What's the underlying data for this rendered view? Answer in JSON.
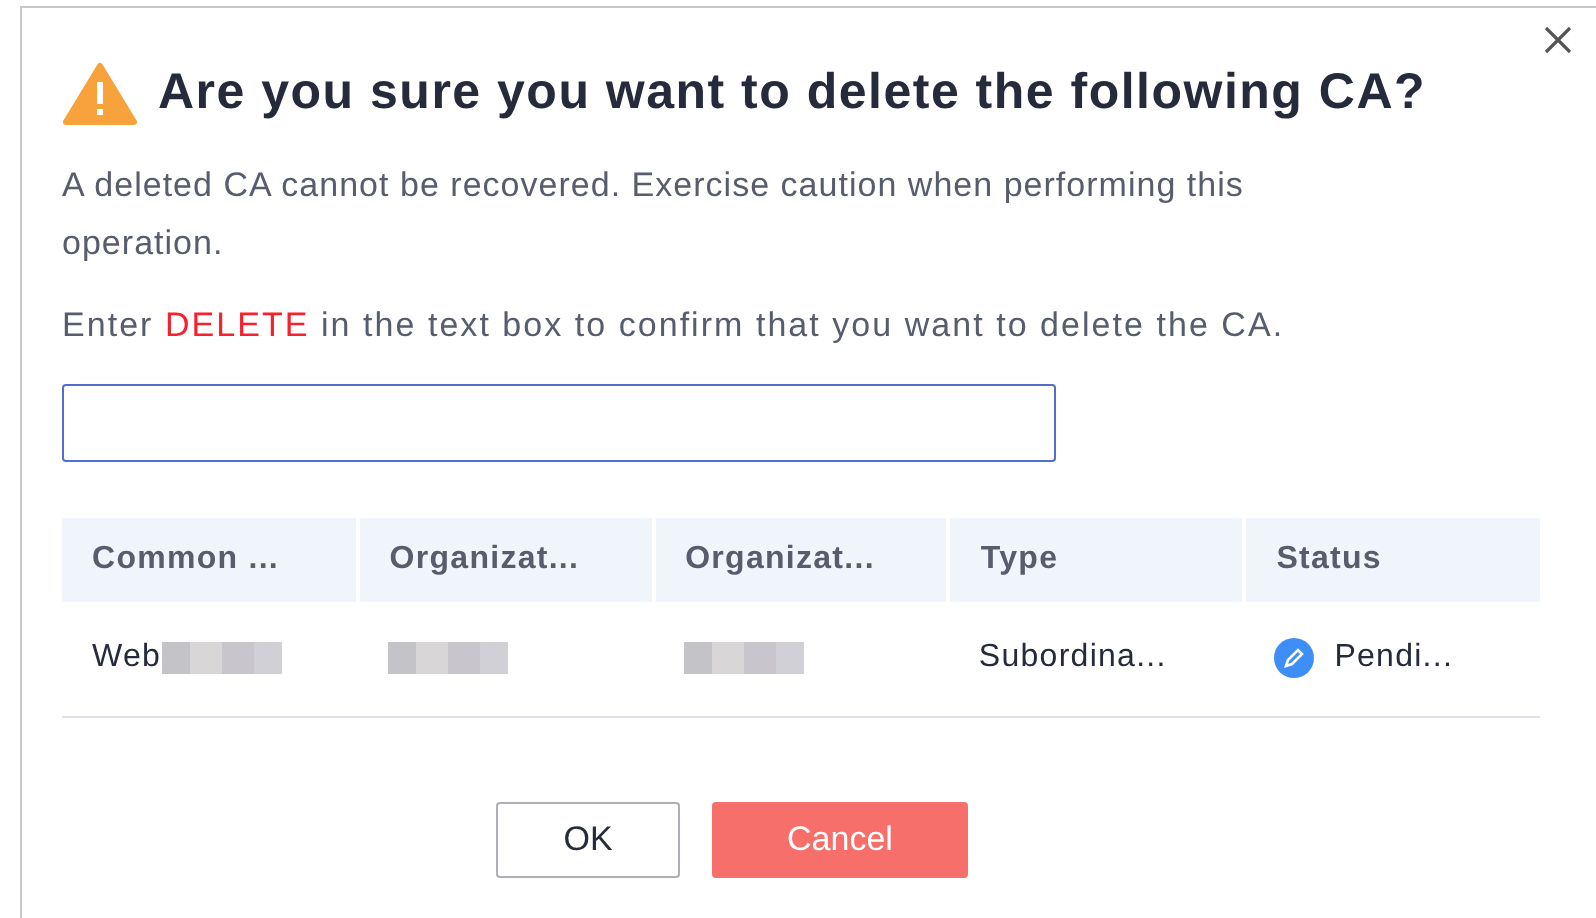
{
  "dialog": {
    "title": "Are you sure you want to delete the following CA?",
    "warning": "A deleted CA cannot be recovered. Exercise caution when performing this operation.",
    "instruction": {
      "before": "Enter",
      "keyword": "DELETE",
      "after": "in the text box to confirm that you want to delete the CA."
    },
    "table": {
      "columns": [
        "Common ...",
        "Organizat...",
        "Organizat...",
        "Type",
        "Status"
      ],
      "rows": [
        {
          "cells": [
            {
              "text": "Web",
              "redacted": true
            },
            {
              "text": "",
              "redacted": true
            },
            {
              "text": "",
              "redacted": true
            },
            {
              "text": "Subordina...",
              "redacted": false
            },
            {
              "text": "Pendi...",
              "redacted": false,
              "kind": "status"
            }
          ]
        }
      ]
    },
    "buttons": [
      {
        "label": "OK",
        "kind": "secondary"
      },
      {
        "label": "Cancel",
        "kind": "danger"
      }
    ]
  }
}
